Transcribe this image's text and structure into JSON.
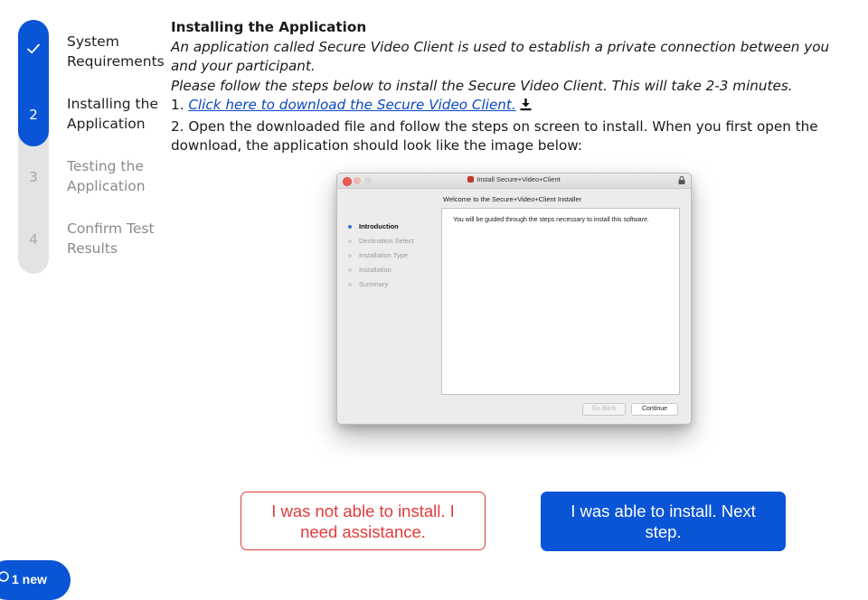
{
  "stepper": {
    "steps": [
      {
        "marker": "✓",
        "label": "System Requirements",
        "state": "done"
      },
      {
        "marker": "2",
        "label": "Installing the Application",
        "state": "current"
      },
      {
        "marker": "3",
        "label": "Testing the Application",
        "state": "todo"
      },
      {
        "marker": "4",
        "label": "Confirm Test Results",
        "state": "todo"
      }
    ]
  },
  "content": {
    "title": "Installing the Application",
    "intro": "An application called Secure Video Client is used to establish a private connection between you and your participant.",
    "instructions": "Please follow the steps below to install the Secure Video Client. This will take 2-3 minutes.",
    "step1_prefix": "1. ",
    "step1_link": "Click here to download the Secure Video Client.",
    "step2": "2. Open the downloaded file and follow the steps on screen to install. When you first open the download, the application should look like the image below:"
  },
  "installer": {
    "window_title": "Install Secure+Video+Client",
    "heading": "Welcome to the Secure+Video+Client Installer",
    "sidebar": [
      "Introduction",
      "Destination Select",
      "Installation Type",
      "Installation",
      "Summary"
    ],
    "body_text": "You will be guided through the steps necessary to install this software.",
    "go_back_label": "Go Back",
    "continue_label": "Continue"
  },
  "actions": {
    "fail_label": "I was not able to install. I need assistance.",
    "success_label": "I was able to install. Next step."
  },
  "chat": {
    "label": "1 new"
  },
  "colors": {
    "accent": "#0a55d6",
    "danger": "#e23b3b",
    "link": "#0a46c7"
  }
}
